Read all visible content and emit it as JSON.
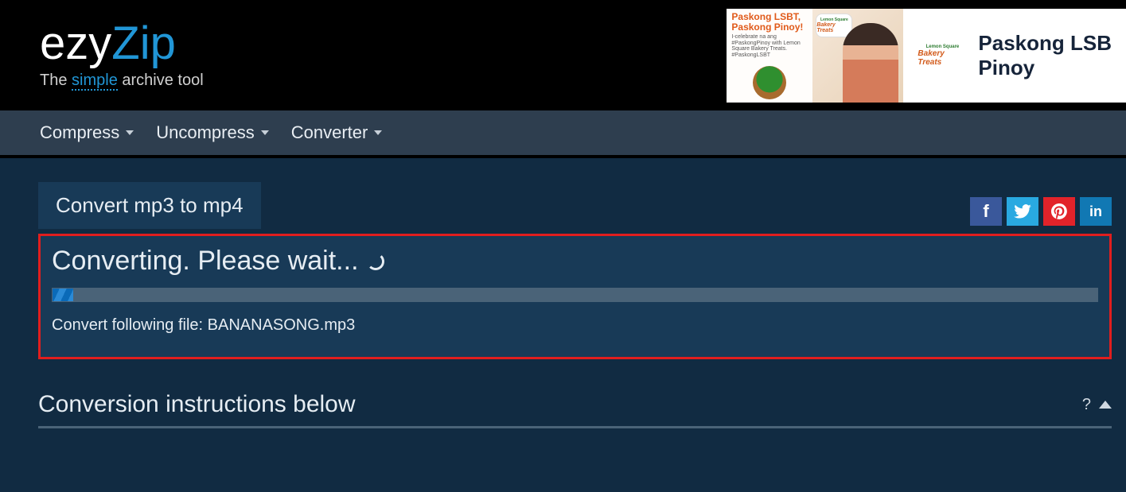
{
  "brand": {
    "part1": "ezy",
    "part2": "Zip",
    "tagline_pre": "The ",
    "tagline_em": "simple",
    "tagline_post": " archive tool"
  },
  "ad": {
    "left_title": "Paskong LSBT, Paskong Pinoy!",
    "left_sub": "I-celebrate na ang #PaskongPinoy with Lemon Square Bakery Treats. #PaskongLSBT",
    "badge_top": "Lemon Square",
    "badge_bottom": "Bakery Treats",
    "right_line1": "Paskong LSB",
    "right_line2": "Pinoy"
  },
  "nav": {
    "items": [
      {
        "label": "Compress"
      },
      {
        "label": "Uncompress"
      },
      {
        "label": "Converter"
      }
    ]
  },
  "tab": {
    "label": "Convert mp3 to mp4"
  },
  "socials": {
    "fb": "f",
    "pin": "P",
    "lin": "in"
  },
  "panel": {
    "title": "Converting. Please wait...",
    "progress_percent": 2,
    "file_line_prefix": "Convert following file: ",
    "file_name": "BANANASONG.mp3"
  },
  "instructions": {
    "title": "Conversion instructions below",
    "help": "?"
  }
}
